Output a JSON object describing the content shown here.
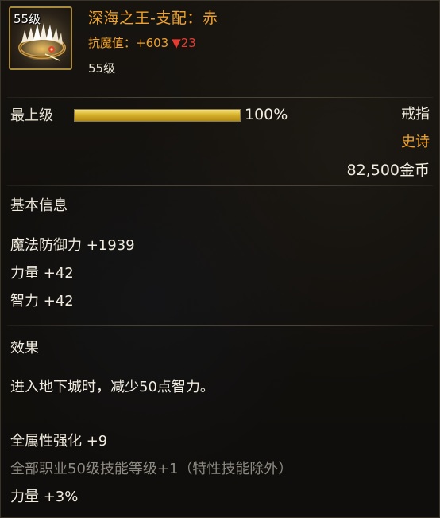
{
  "item": {
    "level_badge": "55级",
    "name": "深海之王-支配：赤",
    "stat_label": "抗魔值：+603",
    "stat_down": "▼23",
    "required_level": "55级"
  },
  "upgrade": {
    "grade_label": "最上级",
    "grade_percent": "100%",
    "grade_fill_percent": 100,
    "item_type": "戒指",
    "rarity": "史诗",
    "price": "82,500金币"
  },
  "basic_info": {
    "title": "基本信息",
    "stats": [
      "魔法防御力 +1939",
      "力量 +42",
      "智力 +42"
    ]
  },
  "effects": {
    "title": "效果",
    "dungeon_effect": "进入地下城时，减少50点智力。",
    "bonus_lines": [
      {
        "text": "全属性强化 +9",
        "muted": false
      },
      {
        "text": "全部职业50级技能等级+1（特性技能除外）",
        "muted": true
      },
      {
        "text": "力量 +3%",
        "muted": false
      }
    ]
  },
  "colors": {
    "epic": "#f0a22c",
    "decrease": "#e83a30",
    "bar_fill": "#d7b22c"
  }
}
